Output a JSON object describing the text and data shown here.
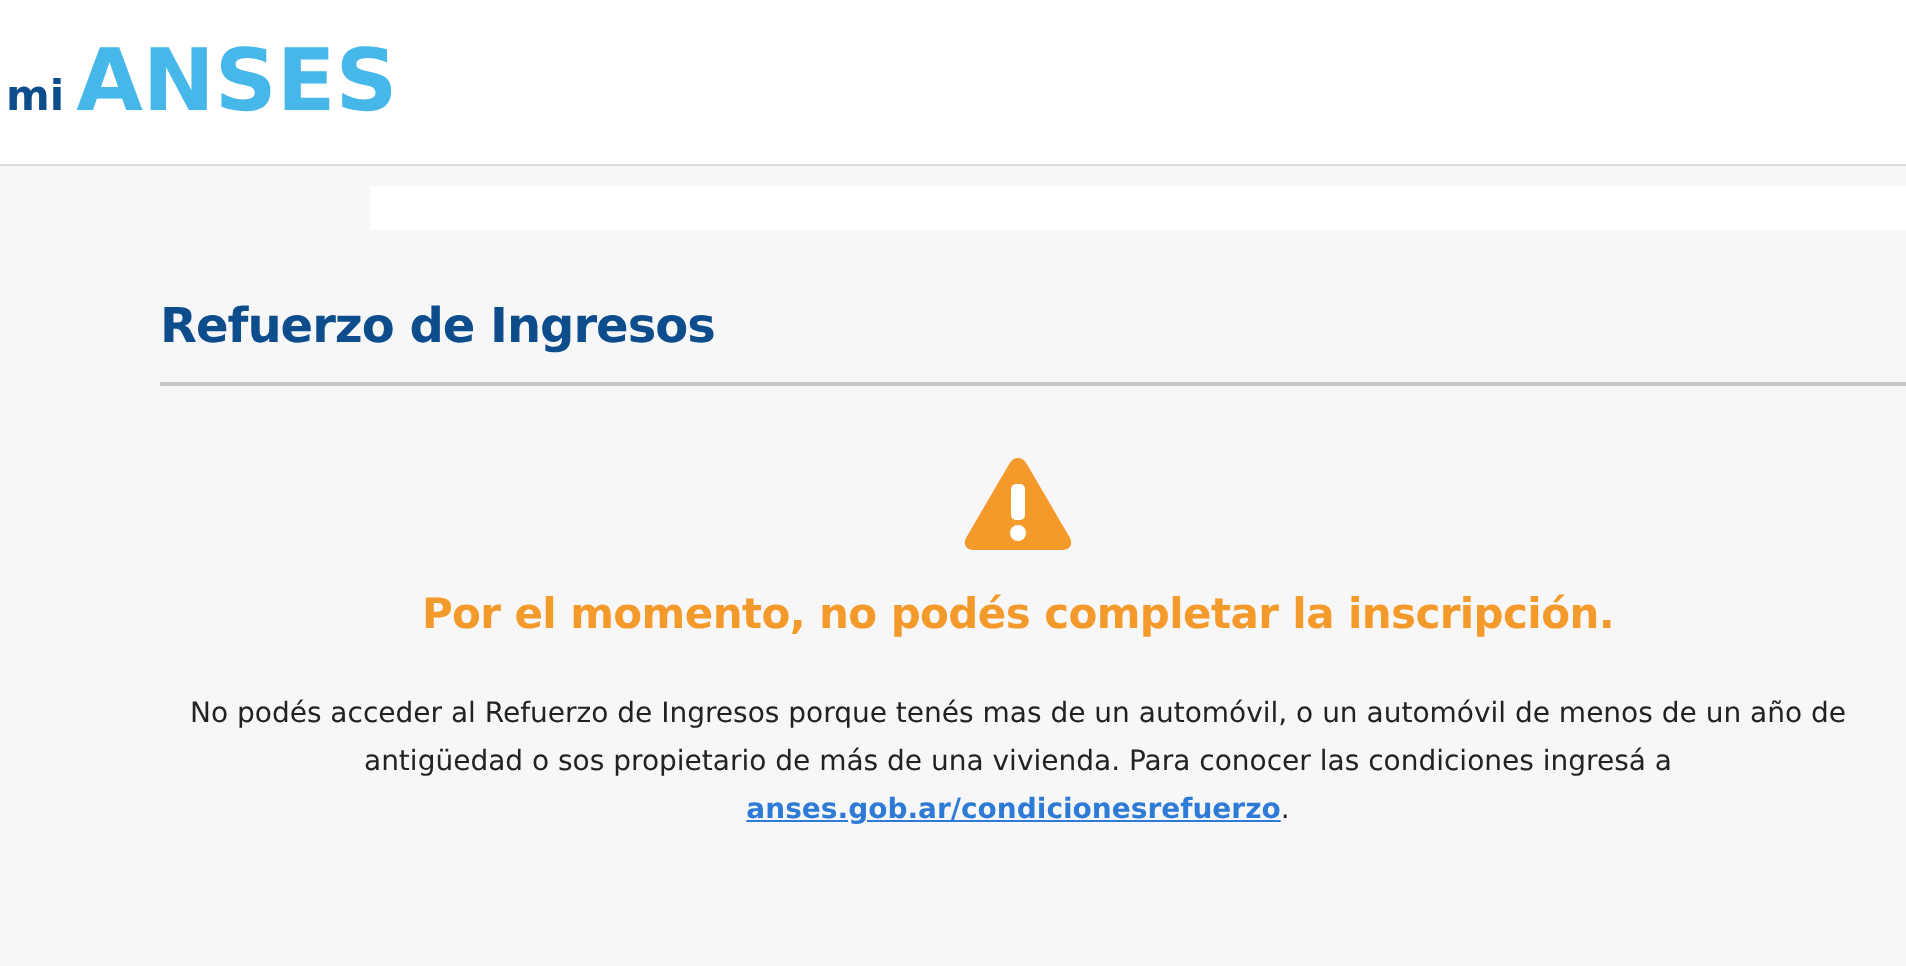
{
  "logo": {
    "prefix": "mi",
    "name": "ANSES"
  },
  "title": "Refuerzo de Ingresos",
  "alert": {
    "heading": "Por el momento, no podés completar la inscripción.",
    "text": "No podés acceder al Refuerzo de Ingresos porque tenés mas de un automóvil, o un automóvil de menos de un año de antigüedad o sos propietario de más de una vivienda. Para conocer las condiciones ingresá a",
    "link": "anses.gob.ar/condicionesrefuerzo",
    "after": "."
  }
}
